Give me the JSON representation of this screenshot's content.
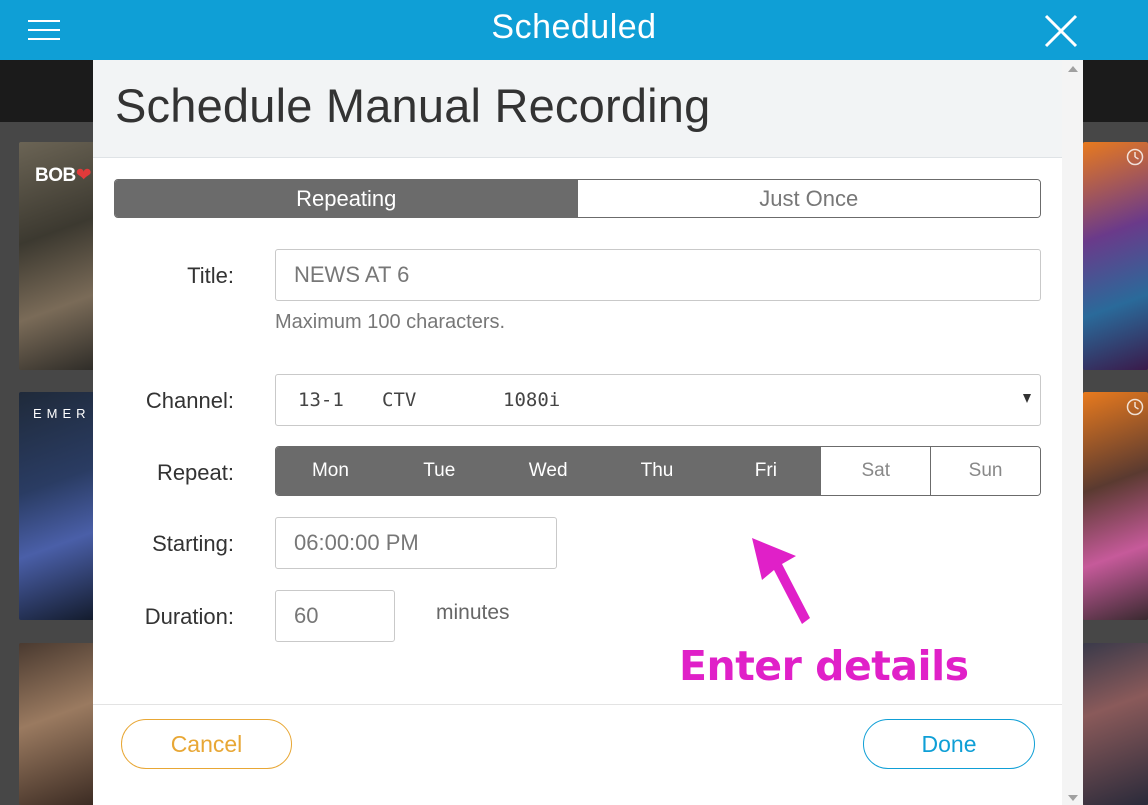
{
  "app": {
    "title": "Scheduled",
    "menu_icon": "hamburger-menu-icon",
    "close_icon": "close-icon",
    "accent_color": "#0f9fd6"
  },
  "background_posters": {
    "left_top_text_a": "BOB",
    "left_top_text_b": "❤",
    "left_mid_text": "EMER",
    "badge_icon": "clock-icon"
  },
  "modal": {
    "title": "Schedule Manual Recording",
    "mode_toggle": {
      "options": [
        "Repeating",
        "Just Once"
      ],
      "selected": "Repeating"
    },
    "form": {
      "title_label": "Title:",
      "title_value": "NEWS AT 6",
      "title_hint": "Maximum 100 characters.",
      "channel_label": "Channel:",
      "channel": {
        "number": "13-1",
        "name": "CTV",
        "resolution": "1080i",
        "dropdown_icon": "caret-down-icon"
      },
      "repeat_label": "Repeat:",
      "days": [
        {
          "label": "Mon",
          "selected": true
        },
        {
          "label": "Tue",
          "selected": true
        },
        {
          "label": "Wed",
          "selected": true
        },
        {
          "label": "Thu",
          "selected": true
        },
        {
          "label": "Fri",
          "selected": true
        },
        {
          "label": "Sat",
          "selected": false
        },
        {
          "label": "Sun",
          "selected": false
        }
      ],
      "starting_label": "Starting:",
      "starting_value": "06:00:00 PM",
      "duration_label": "Duration:",
      "duration_value": "60",
      "duration_unit": "minutes"
    },
    "buttons": {
      "cancel": "Cancel",
      "done": "Done",
      "cancel_color": "#e8a735",
      "done_color": "#0f9fd6"
    }
  },
  "annotation": {
    "text": "Enter details",
    "color": "#e020c8",
    "icon": "pointer-arrow-icon"
  }
}
